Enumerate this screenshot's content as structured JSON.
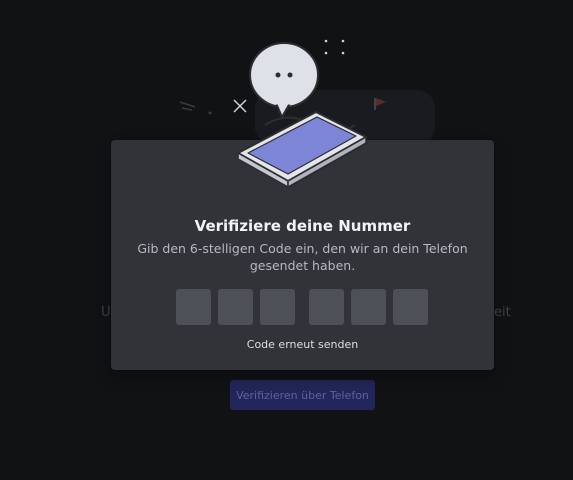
{
  "background": {
    "left_fragment": "U",
    "right_fragment": "eit",
    "verify_button_label": "Verifizieren über Telefon"
  },
  "modal": {
    "title": "Verifiziere deine Nummer",
    "subtitle": "Gib den 6-stelligen Code ein, den wir an dein Telefon gesendet haben.",
    "code_digits": [
      "",
      "",
      "",
      "",
      "",
      ""
    ],
    "resend_label": "Code erneut senden"
  },
  "icons": {
    "speech_bubble": "speech-bubble-icon",
    "phone": "phone-icon",
    "sparkle": "sparkle-icon",
    "flag": "flag-icon"
  },
  "colors": {
    "page_background": "#111214",
    "modal_background": "#313338",
    "code_box": "#4e5058",
    "button_blurple_dimmed": "#23265a",
    "phone_screen": "#7d85d6",
    "flag": "#ed4245"
  }
}
